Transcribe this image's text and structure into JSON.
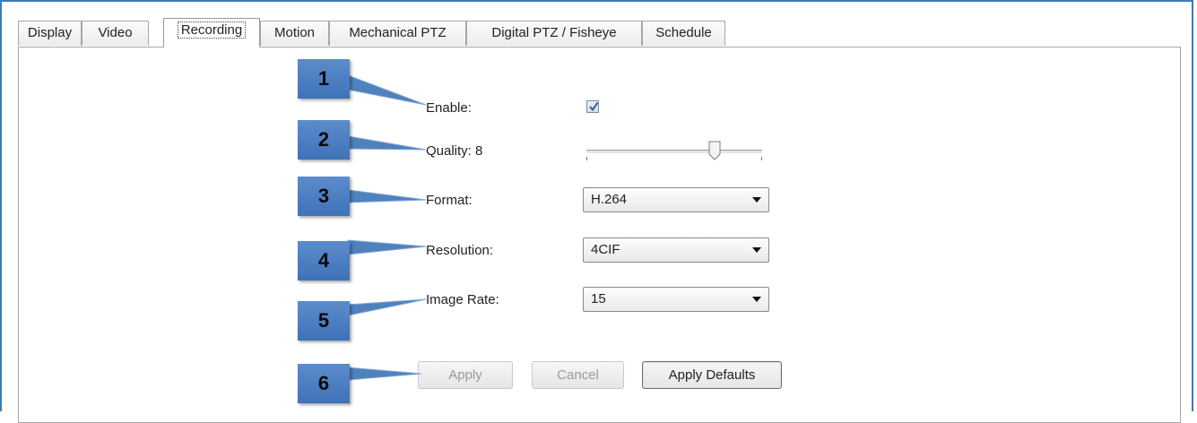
{
  "tabs": [
    {
      "label": "Display",
      "active": false
    },
    {
      "label": "Video",
      "active": false
    },
    {
      "label": "Recording",
      "active": true
    },
    {
      "label": "Motion",
      "active": false
    },
    {
      "label": "Mechanical PTZ",
      "active": false
    },
    {
      "label": "Digital PTZ / Fisheye",
      "active": false
    },
    {
      "label": "Schedule",
      "active": false
    }
  ],
  "form": {
    "enable_label": "Enable:",
    "enable_checked": true,
    "quality_label": "Quality: 8",
    "quality_level": 0.73,
    "format_label": "Format:",
    "format_value": "H.264",
    "resolution_label": "Resolution:",
    "resolution_value": "4CIF",
    "image_rate_label": "Image Rate:",
    "image_rate_value": "15"
  },
  "buttons": {
    "apply": "Apply",
    "cancel": "Cancel",
    "apply_defaults": "Apply Defaults"
  },
  "callouts": [
    "1",
    "2",
    "3",
    "4",
    "5",
    "6"
  ],
  "colors": {
    "frame_border": "#3d7ac0",
    "callout_fill": "#4f81bd",
    "check_mark": "#3b5fa3"
  }
}
